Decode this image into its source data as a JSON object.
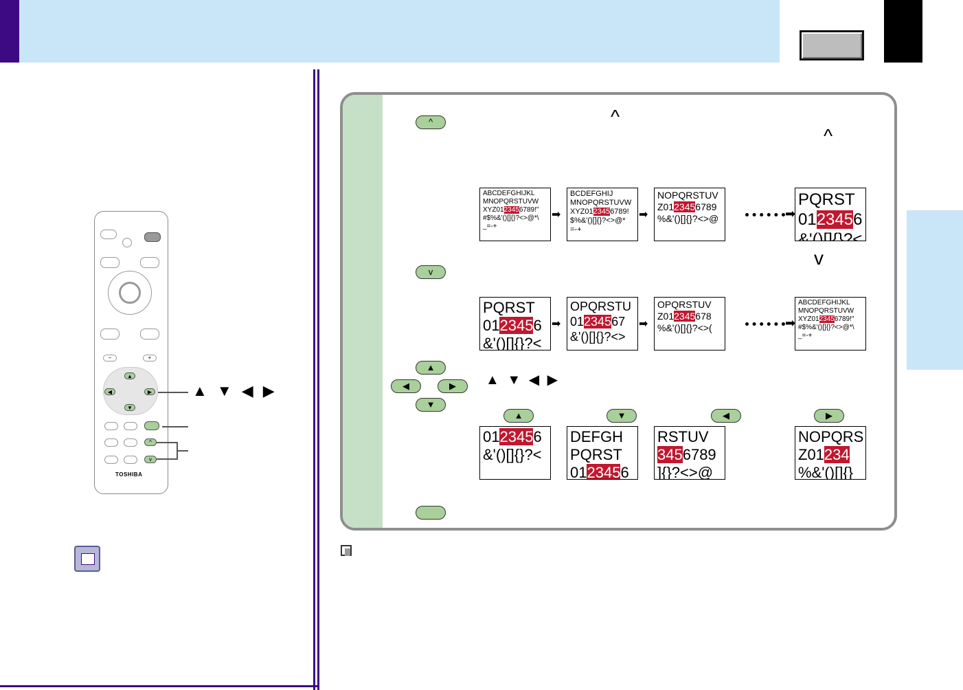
{
  "remote": {
    "brand": "TOSHIBA",
    "button_minus": "−",
    "button_plus": "+"
  },
  "callouts": {
    "arrows_label": "▲ ▼ ◀ ▶"
  },
  "panel": {
    "step1": {
      "caret_up_label": "^",
      "glyph_mid": "^",
      "glyph_right": "^"
    },
    "step2": {
      "caret_down_label": "v",
      "glyph_right": "v"
    },
    "step3": {
      "arrows_inline": "▲ ▼ ◀ ▶",
      "up": "▲",
      "down": "▼",
      "left": "◀",
      "right": "▶"
    },
    "zoom_in_thumbs": [
      [
        "ABCDEFGHIJKL",
        "MNOPQRSTUVW",
        [
          "XYZ01",
          "2345",
          "6789!\""
        ],
        "#$%&'()[]{}?<>@*\\",
        "_=-+"
      ],
      [
        "BCDEFGHIJ",
        "MNOPQRSTUVW",
        [
          "XYZ01",
          "2345",
          "6789!"
        ],
        "$%&'()[]{}?<>@*",
        "=-+"
      ],
      [
        "NOPQRSTUV",
        [
          "Z01",
          "2345",
          "6789"
        ],
        "%&'()[]{}?<>@",
        ""
      ],
      [
        "PQRST",
        [
          "01",
          "2345",
          "6"
        ],
        "&'()[]{}?<"
      ]
    ],
    "zoom_out_thumbs": [
      [
        "PQRST",
        [
          "01",
          "2345",
          "6"
        ],
        "&'()[]{}?<"
      ],
      [
        "OPQRSTU",
        [
          "01",
          "2345",
          "67"
        ],
        "&'()[]{}?<>"
      ],
      [
        "OPQRSTUV",
        [
          "Z01",
          "2345",
          "678"
        ],
        "%&'()[]{}?<>("
      ],
      [
        "ABCDEFGHIJKL",
        "MNOPQRSTUVW",
        [
          "XYZ01",
          "2345",
          "6789!\""
        ],
        "#$%&'()[]{}?<>@*\\",
        "_=-+"
      ]
    ],
    "pan_thumbs": [
      [
        [
          "01",
          "2345",
          "6"
        ],
        "&'()[]{}?<"
      ],
      [
        "DEFGH",
        "PQRST",
        [
          "01",
          "2345",
          "6"
        ]
      ],
      [
        "RSTUV",
        [
          "",
          "345",
          "6789"
        ],
        "]{}?<>@"
      ],
      [
        "NOPQRS",
        [
          "Z01",
          "234",
          ""
        ],
        "%&'()[]{}"
      ]
    ]
  }
}
